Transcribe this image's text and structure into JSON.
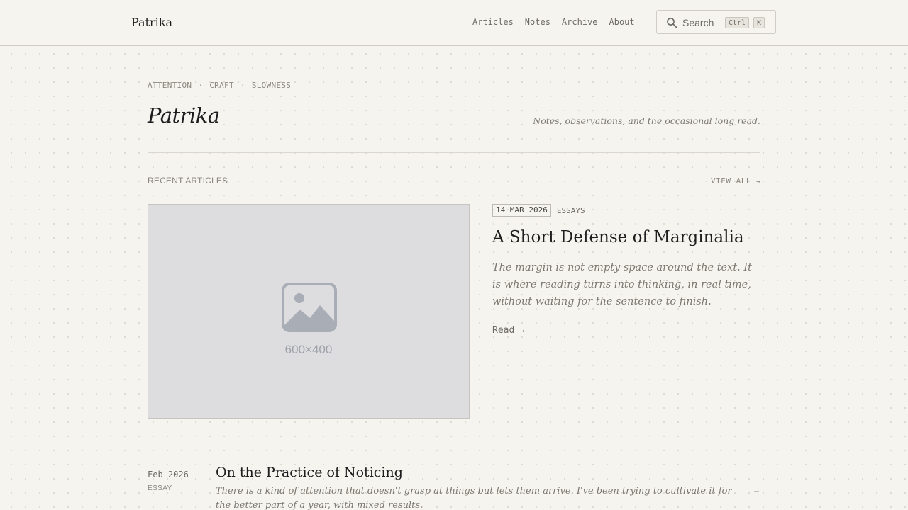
{
  "header": {
    "brand": "Patrika",
    "nav": [
      "Articles",
      "Notes",
      "Archive",
      "About"
    ],
    "search": {
      "label": "Search",
      "shortcut_ctrl": "Ctrl",
      "shortcut_key": "K",
      "icon": "search-icon"
    }
  },
  "intro": {
    "eyebrow": [
      "ATTENTION",
      "CRAFT",
      "SLOWNESS"
    ],
    "eyebrow_separator": "·",
    "title": "Patrika",
    "tagline": "Notes, observations, and the occasional long read."
  },
  "recent": {
    "heading": "RECENT ARTICLES",
    "view_all": "VIEW ALL",
    "view_all_arrow": "→",
    "featured": {
      "image_placeholder": "600×400",
      "image_icon": "image-placeholder-icon",
      "date": "14 MAR 2026",
      "category": "ESSAYS",
      "title": "A Short Defense of Marginalia",
      "excerpt": "The margin is not empty space around the text. It is where reading turns into thinking, in real time, without waiting for the sentence to finish.",
      "read_label": "Read",
      "read_arrow": "→"
    },
    "items": [
      {
        "date": "Feb 2026",
        "type": "ESSAY",
        "title": "On the Practice of Noticing",
        "excerpt": "There is a kind of attention that doesn't grasp at things but lets them arrive. I've been trying to cultivate it for the better part of a year, with mixed results.",
        "arrow": "→"
      }
    ]
  },
  "colors": {
    "background": "#f5f4ee",
    "text": "#1e1e1e",
    "muted": "#7a7870",
    "rule": "#d9d7cf",
    "placeholder": "#dddde0"
  }
}
